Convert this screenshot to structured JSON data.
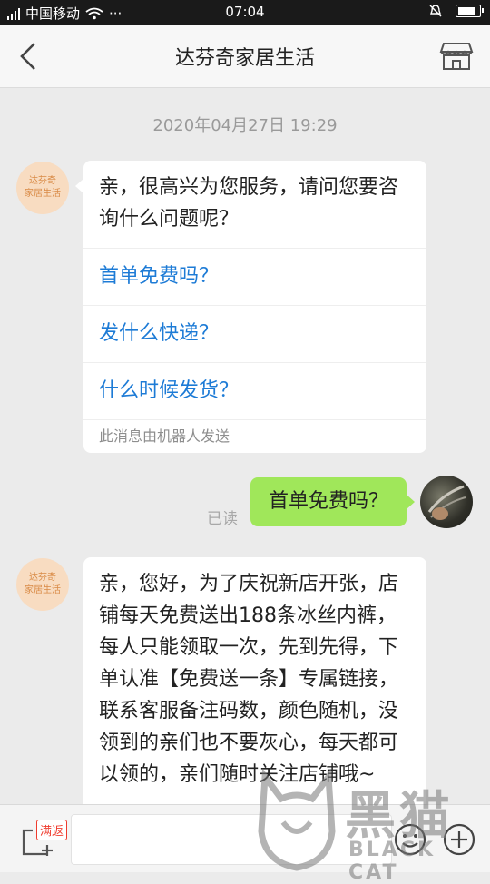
{
  "status_bar": {
    "carrier": "中国移动",
    "network_tag": "4G",
    "time": "07:04",
    "dots": "···"
  },
  "header": {
    "title": "达芬奇家居生活"
  },
  "chat": {
    "timestamp": "2020年04月27日 19:29",
    "shop_avatar_label": "达芬奇\n家居生活",
    "welcome": {
      "greeting": "亲，很高兴为您服务，请问您要咨询什么问题呢？",
      "quick_questions": [
        "首单免费吗？",
        "发什么快递？",
        "什么时候发货？"
      ],
      "robot_note": "此消息由机器人发送"
    },
    "user_message": {
      "text": "首单免费吗？",
      "read_status": "已读"
    },
    "reply": {
      "text": "亲，您好，为了庆祝新店开张，店铺每天免费送出188条冰丝内裤，每人只能领取一次，先到先得，下单认准【免费送一条】专属链接，联系客服备注码数，颜色随机，没领到的亲们也不要灰心，每天都可以领的，亲们随时关注店铺哦~"
    }
  },
  "bottom_bar": {
    "promo_badge": "满返",
    "input_placeholder": ""
  },
  "watermark": {
    "cn": "黑猫",
    "en": "BLACK CAT"
  },
  "colors": {
    "accent_link": "#1d7bd6",
    "my_bubble": "#a0e75a",
    "badge_red": "#ef3b2d"
  }
}
